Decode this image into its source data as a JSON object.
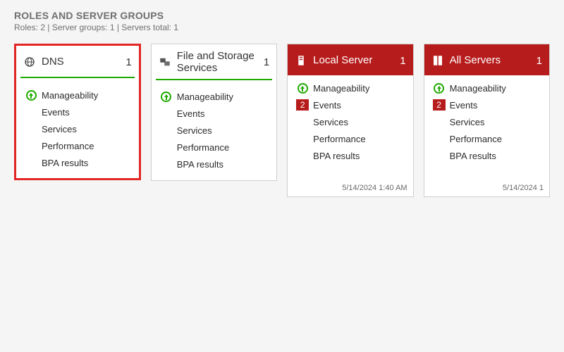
{
  "section": {
    "title": "ROLES AND SERVER GROUPS",
    "subtitle": "Roles: 2  |  Server groups: 1  |  Servers total: 1"
  },
  "tiles": [
    {
      "id": "dns",
      "title": "DNS",
      "count": "1",
      "headerStyle": "light",
      "rule": true,
      "highlight": true,
      "iconName": "dns-icon",
      "items": [
        {
          "label": "Manageability",
          "indicator": "up"
        },
        {
          "label": "Events",
          "indicator": ""
        },
        {
          "label": "Services",
          "indicator": ""
        },
        {
          "label": "Performance",
          "indicator": ""
        },
        {
          "label": "BPA results",
          "indicator": ""
        }
      ],
      "timestamp": ""
    },
    {
      "id": "file-storage",
      "title": "File and Storage Services",
      "count": "1",
      "headerStyle": "light",
      "rule": true,
      "highlight": false,
      "iconName": "storage-icon",
      "items": [
        {
          "label": "Manageability",
          "indicator": "up"
        },
        {
          "label": "Events",
          "indicator": ""
        },
        {
          "label": "Services",
          "indicator": ""
        },
        {
          "label": "Performance",
          "indicator": ""
        },
        {
          "label": "BPA results",
          "indicator": ""
        }
      ],
      "timestamp": ""
    },
    {
      "id": "local-server",
      "title": "Local Server",
      "count": "1",
      "headerStyle": "red",
      "rule": false,
      "highlight": false,
      "iconName": "server-icon",
      "items": [
        {
          "label": "Manageability",
          "indicator": "up"
        },
        {
          "label": "Events",
          "indicator": "badge",
          "badge": "2"
        },
        {
          "label": "Services",
          "indicator": ""
        },
        {
          "label": "Performance",
          "indicator": ""
        },
        {
          "label": "BPA results",
          "indicator": ""
        }
      ],
      "timestamp": "5/14/2024 1:40 AM"
    },
    {
      "id": "all-servers",
      "title": "All Servers",
      "count": "1",
      "headerStyle": "red",
      "rule": false,
      "highlight": false,
      "iconName": "servers-icon",
      "items": [
        {
          "label": "Manageability",
          "indicator": "up"
        },
        {
          "label": "Events",
          "indicator": "badge",
          "badge": "2"
        },
        {
          "label": "Services",
          "indicator": ""
        },
        {
          "label": "Performance",
          "indicator": ""
        },
        {
          "label": "BPA results",
          "indicator": ""
        }
      ],
      "timestamp": "5/14/2024 1"
    }
  ]
}
